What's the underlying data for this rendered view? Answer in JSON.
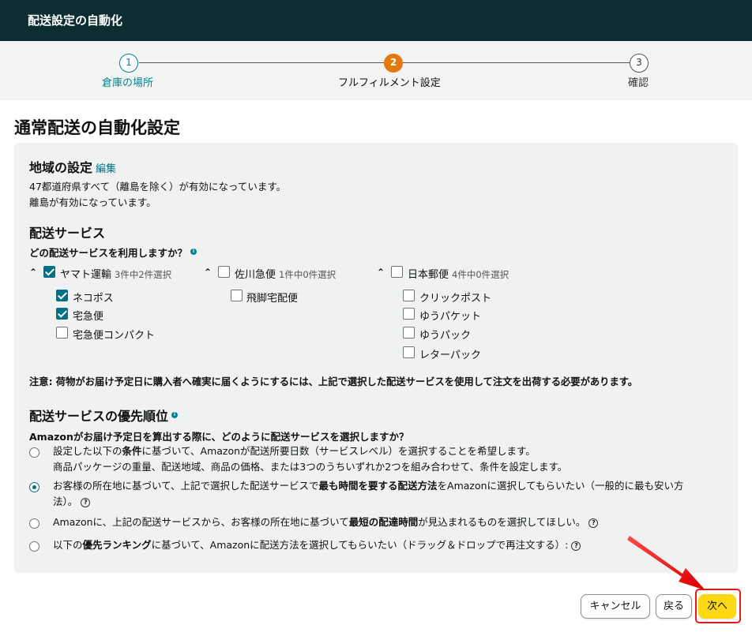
{
  "header": {
    "title": "配送設定の自動化"
  },
  "stepper": {
    "steps": [
      {
        "num": "1",
        "label": "倉庫の場所",
        "state": "done"
      },
      {
        "num": "2",
        "label": "フルフィルメント設定",
        "state": "active"
      },
      {
        "num": "3",
        "label": "確認",
        "state": "pending"
      }
    ]
  },
  "page_title": "通常配送の自動化設定",
  "region": {
    "title": "地域の設定",
    "edit_link": "編集",
    "line1": "47都道府県すべて（離島を除く）が有効になっています。",
    "line2": "離島が有効になっています。"
  },
  "services": {
    "title": "配送サービス",
    "question": "どの配送サービスを利用しますか？",
    "carriers": [
      {
        "name": "ヤマト運輸",
        "sub": "3件中2件選択",
        "checked": true,
        "options": [
          {
            "label": "ネコポス",
            "checked": true
          },
          {
            "label": "宅急便",
            "checked": true
          },
          {
            "label": "宅急便コンパクト",
            "checked": false
          }
        ]
      },
      {
        "name": "佐川急便",
        "sub": "1件中0件選択",
        "checked": false,
        "options": [
          {
            "label": "飛脚宅配便",
            "checked": false
          }
        ]
      },
      {
        "name": "日本郵便",
        "sub": "4件中0件選択",
        "checked": false,
        "options": [
          {
            "label": "クリックポスト",
            "checked": false
          },
          {
            "label": "ゆうパケット",
            "checked": false
          },
          {
            "label": "ゆうパック",
            "checked": false
          },
          {
            "label": "レターパック",
            "checked": false
          }
        ]
      }
    ],
    "note": "注意: 荷物がお届け予定日に購入者へ確実に届くようにするには、上記で選択した配送サービスを使用して注文を出荷する必要があります。"
  },
  "priority": {
    "title": "配送サービスの優先順位",
    "question": "Amazonがお届け予定日を算出する際に、どのように配送サービスを選択しますか？",
    "options": [
      {
        "a": "設定した以下の",
        "b": "条件",
        "c": "に基づいて、Amazonが配送所要日数（サービスレベル）を選択することを希望します。",
        "line2": "商品パッケージの重量、配送地域、商品の価格、または3つのうちいずれか2つを組み合わせて、条件を設定します。",
        "checked": false
      },
      {
        "a": "お客様の所在地に基づいて、上記で選択した配送サービスで",
        "b": "最も時間を要する配送方法",
        "c": "をAmazonに選択してもらいたい（一般的に最も安い方",
        "line2": "法）。",
        "checked": true
      },
      {
        "a": "Amazonに、上記の配送サービスから、お客様の所在地に基づいて",
        "b": "最短の配達時間",
        "c": "が見込まれるものを選択してほしい。",
        "line2": "",
        "checked": false
      },
      {
        "a": "以下の",
        "b": "優先ランキング",
        "c": "に基づいて、Amazonに配送方法を選択してもらいたい（ドラッグ＆ドロップで再注文する）:",
        "line2": "",
        "checked": false
      }
    ]
  },
  "buttons": {
    "cancel": "キャンセル",
    "back": "戻る",
    "next": "次へ"
  },
  "colors": {
    "header": "#0d2d33",
    "accent": "#008296",
    "active_step": "#e47911",
    "primary_button": "#ffd814",
    "highlight": "#e31a1a"
  },
  "icons": {
    "info": "info-icon",
    "help": "question-circle-icon",
    "expand": "chevron-up-icon",
    "annotation": "red-arrow"
  }
}
